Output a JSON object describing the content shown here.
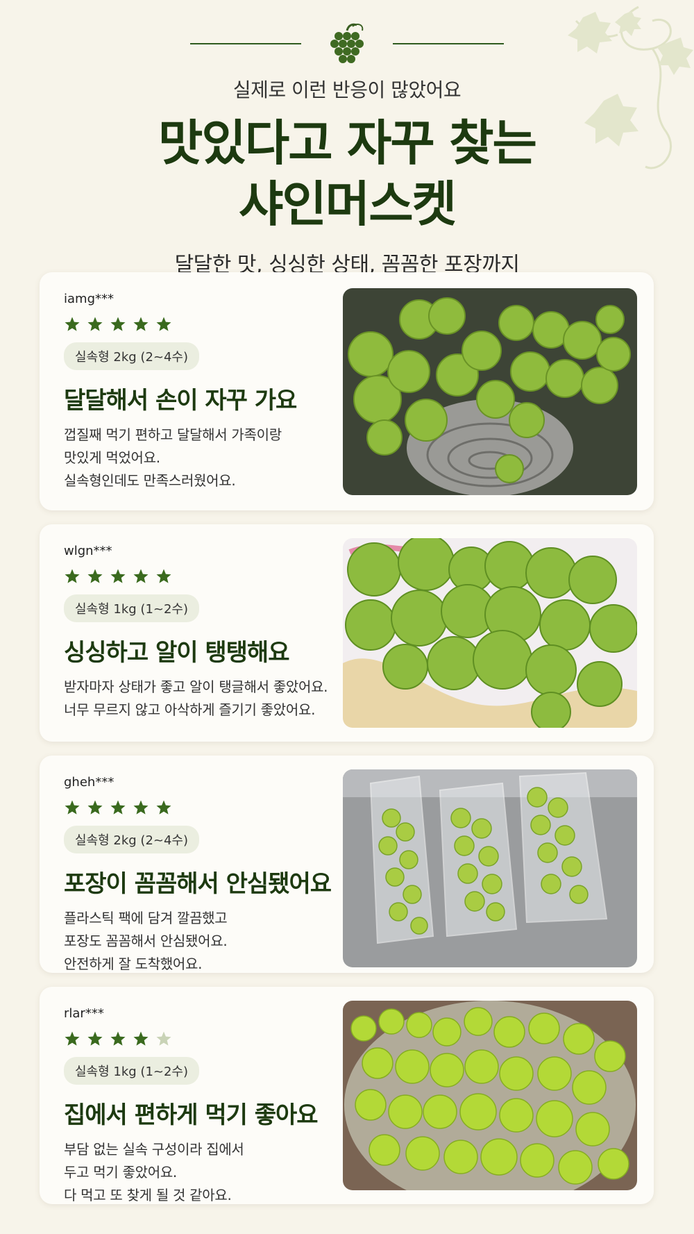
{
  "header": {
    "subtitle": "실제로 이런 반응이 많았어요",
    "title_line1": "맛있다고 자꾸 찾는",
    "title_line2": "샤인머스켓",
    "tagline": "달달한 맛, 싱싱한 상태, 꼼꼼한 포장까지"
  },
  "colors": {
    "accent": "#1d3a10",
    "star_filled": "#3a6a1e",
    "star_empty": "#c9d3b6",
    "badge_bg": "#ebeee0",
    "background": "#f7f4ea"
  },
  "reviews": [
    {
      "reviewer": "iamg***",
      "rating": 5,
      "option": "실속형 2kg (2~4수)",
      "title": "달달해서 손이 자꾸 가요",
      "body": "껍질째 먹기 편하고 달달해서 가족이랑\n맛있게 먹었어요.\n실속형인데도 만족스러웠어요.",
      "photo_icon": "grapes-in-colander-photo"
    },
    {
      "reviewer": "wlgn***",
      "rating": 5,
      "option": "실속형 1kg (1~2수)",
      "title": "싱싱하고 알이 탱탱해요",
      "body": "받자마자 상태가 좋고 알이 탱글해서 좋았어요.\n너무 무르지 않고 아삭하게 즐기기 좋았어요.",
      "photo_icon": "grapes-on-plate-photo"
    },
    {
      "reviewer": "gheh***",
      "rating": 5,
      "option": "실속형 2kg (2~4수)",
      "title": "포장이 꼼꼼해서 안심됐어요",
      "body": "플라스틱 팩에 담겨 깔끔했고\n포장도 꼼꼼해서 안심됐어요.\n안전하게 잘 도착했어요.",
      "photo_icon": "packaged-grapes-photo"
    },
    {
      "reviewer": "rlar***",
      "rating": 4,
      "option": "실속형 1kg (1~2수)",
      "title": "집에서 편하게 먹기 좋아요",
      "body": "부담 없는 실속 구성이라 집에서\n두고 먹기 좋았어요.\n다 먹고 또 찾게 될 것 같아요.",
      "photo_icon": "grapes-in-bowl-photo"
    }
  ]
}
